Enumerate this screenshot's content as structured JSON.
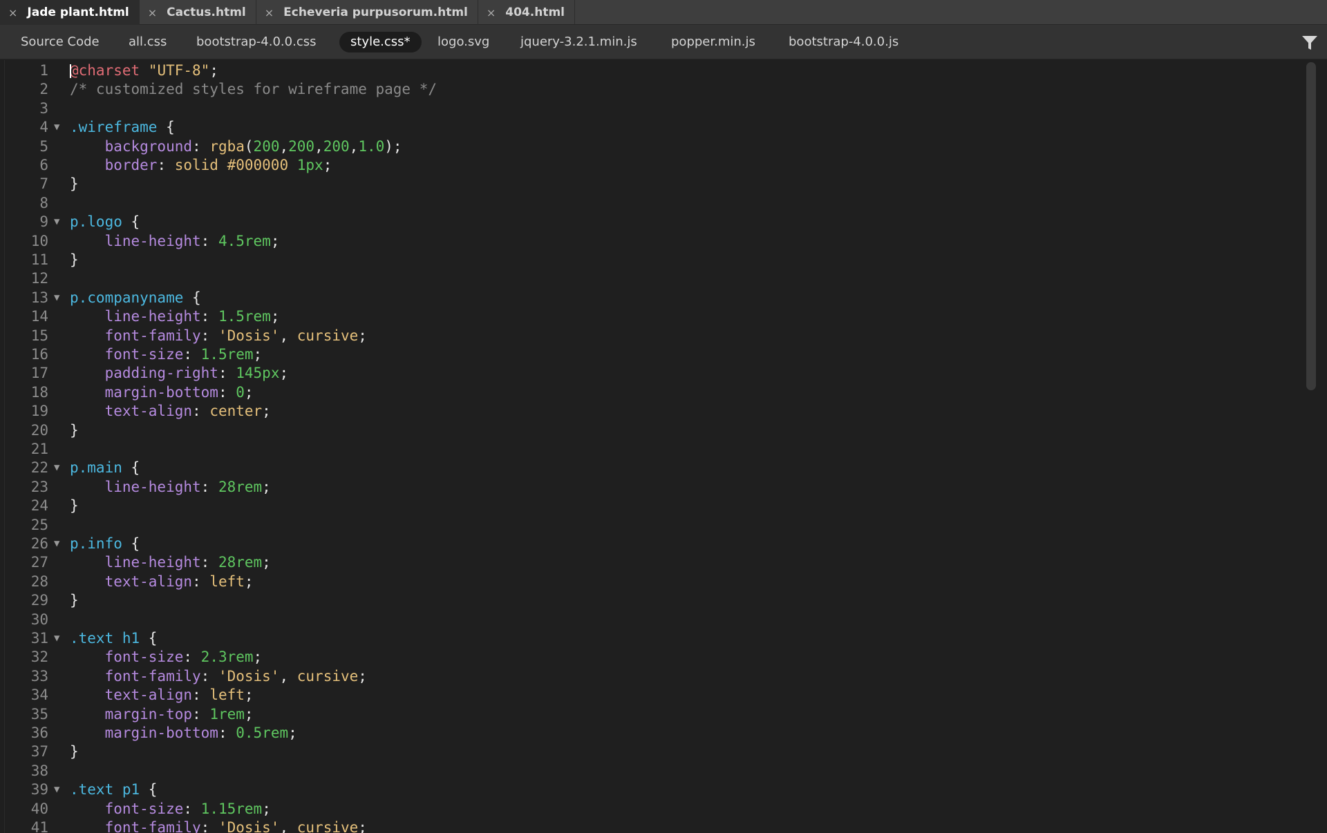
{
  "file_tabs": [
    {
      "name": "Jade plant.html",
      "active": true
    },
    {
      "name": "Cactus.html",
      "active": false
    },
    {
      "name": "Echeveria purpusorum.html",
      "active": false
    },
    {
      "name": "404.html",
      "active": false
    }
  ],
  "close_glyph": "×",
  "related_files": [
    {
      "name": "Source Code",
      "active": false
    },
    {
      "name": "all.css",
      "active": false
    },
    {
      "name": "bootstrap-4.0.0.css",
      "active": false
    },
    {
      "name": "style.css*",
      "active": true
    },
    {
      "name": "logo.svg",
      "active": false
    },
    {
      "name": "jquery-3.2.1.min.js",
      "active": false
    },
    {
      "name": "popper.min.js",
      "active": false
    },
    {
      "name": "bootstrap-4.0.0.js",
      "active": false
    }
  ],
  "filter_icon": "filter-funnel-icon",
  "fold_glyph": "▼",
  "code_lines": [
    {
      "n": "1",
      "fold": false,
      "tokens": [
        [
          "at",
          "@charset"
        ],
        [
          "punc",
          " "
        ],
        [
          "str",
          "\"UTF-8\""
        ],
        [
          "punc",
          ";"
        ]
      ]
    },
    {
      "n": "2",
      "fold": false,
      "tokens": [
        [
          "comment",
          "/* customized styles for wireframe page */"
        ]
      ]
    },
    {
      "n": "3",
      "fold": false,
      "tokens": []
    },
    {
      "n": "4",
      "fold": true,
      "tokens": [
        [
          "sel",
          ".wireframe"
        ],
        [
          "punc",
          " {"
        ]
      ]
    },
    {
      "n": "5",
      "fold": false,
      "tokens": [
        [
          "punc",
          "    "
        ],
        [
          "prop",
          "background"
        ],
        [
          "punc",
          ": "
        ],
        [
          "val",
          "rgba"
        ],
        [
          "punc",
          "("
        ],
        [
          "num",
          "200"
        ],
        [
          "punc",
          ","
        ],
        [
          "num",
          "200"
        ],
        [
          "punc",
          ","
        ],
        [
          "num",
          "200"
        ],
        [
          "punc",
          ","
        ],
        [
          "num",
          "1.0"
        ],
        [
          "punc",
          ");"
        ]
      ]
    },
    {
      "n": "6",
      "fold": false,
      "tokens": [
        [
          "punc",
          "    "
        ],
        [
          "prop",
          "border"
        ],
        [
          "punc",
          ": "
        ],
        [
          "val",
          "solid #000000"
        ],
        [
          "punc",
          " "
        ],
        [
          "num",
          "1px"
        ],
        [
          "punc",
          ";"
        ]
      ]
    },
    {
      "n": "7",
      "fold": false,
      "tokens": [
        [
          "punc",
          "}"
        ]
      ]
    },
    {
      "n": "8",
      "fold": false,
      "tokens": []
    },
    {
      "n": "9",
      "fold": true,
      "tokens": [
        [
          "sel",
          "p.logo"
        ],
        [
          "punc",
          " {"
        ]
      ]
    },
    {
      "n": "10",
      "fold": false,
      "tokens": [
        [
          "punc",
          "    "
        ],
        [
          "prop",
          "line-height"
        ],
        [
          "punc",
          ": "
        ],
        [
          "num",
          "4.5rem"
        ],
        [
          "punc",
          ";"
        ]
      ]
    },
    {
      "n": "11",
      "fold": false,
      "tokens": [
        [
          "punc",
          "}"
        ]
      ]
    },
    {
      "n": "12",
      "fold": false,
      "tokens": []
    },
    {
      "n": "13",
      "fold": true,
      "tokens": [
        [
          "sel",
          "p.companyname"
        ],
        [
          "punc",
          " {"
        ]
      ]
    },
    {
      "n": "14",
      "fold": false,
      "tokens": [
        [
          "punc",
          "    "
        ],
        [
          "prop",
          "line-height"
        ],
        [
          "punc",
          ": "
        ],
        [
          "num",
          "1.5rem"
        ],
        [
          "punc",
          ";"
        ]
      ]
    },
    {
      "n": "15",
      "fold": false,
      "tokens": [
        [
          "punc",
          "    "
        ],
        [
          "prop",
          "font-family"
        ],
        [
          "punc",
          ": "
        ],
        [
          "str",
          "'Dosis'"
        ],
        [
          "punc",
          ", "
        ],
        [
          "val",
          "cursive"
        ],
        [
          "punc",
          ";"
        ]
      ]
    },
    {
      "n": "16",
      "fold": false,
      "tokens": [
        [
          "punc",
          "    "
        ],
        [
          "prop",
          "font-size"
        ],
        [
          "punc",
          ": "
        ],
        [
          "num",
          "1.5rem"
        ],
        [
          "punc",
          ";"
        ]
      ]
    },
    {
      "n": "17",
      "fold": false,
      "tokens": [
        [
          "punc",
          "    "
        ],
        [
          "prop",
          "padding-right"
        ],
        [
          "punc",
          ": "
        ],
        [
          "num",
          "145px"
        ],
        [
          "punc",
          ";"
        ]
      ]
    },
    {
      "n": "18",
      "fold": false,
      "tokens": [
        [
          "punc",
          "    "
        ],
        [
          "prop",
          "margin-bottom"
        ],
        [
          "punc",
          ": "
        ],
        [
          "num",
          "0"
        ],
        [
          "punc",
          ";"
        ]
      ]
    },
    {
      "n": "19",
      "fold": false,
      "tokens": [
        [
          "punc",
          "    "
        ],
        [
          "prop",
          "text-align"
        ],
        [
          "punc",
          ": "
        ],
        [
          "val",
          "center"
        ],
        [
          "punc",
          ";"
        ]
      ]
    },
    {
      "n": "20",
      "fold": false,
      "tokens": [
        [
          "punc",
          "}"
        ]
      ]
    },
    {
      "n": "21",
      "fold": false,
      "tokens": []
    },
    {
      "n": "22",
      "fold": true,
      "tokens": [
        [
          "sel",
          "p.main"
        ],
        [
          "punc",
          " {"
        ]
      ]
    },
    {
      "n": "23",
      "fold": false,
      "tokens": [
        [
          "punc",
          "    "
        ],
        [
          "prop",
          "line-height"
        ],
        [
          "punc",
          ": "
        ],
        [
          "num",
          "28rem"
        ],
        [
          "punc",
          ";"
        ]
      ]
    },
    {
      "n": "24",
      "fold": false,
      "tokens": [
        [
          "punc",
          "}"
        ]
      ]
    },
    {
      "n": "25",
      "fold": false,
      "tokens": []
    },
    {
      "n": "26",
      "fold": true,
      "tokens": [
        [
          "sel",
          "p.info"
        ],
        [
          "punc",
          " {"
        ]
      ]
    },
    {
      "n": "27",
      "fold": false,
      "tokens": [
        [
          "punc",
          "    "
        ],
        [
          "prop",
          "line-height"
        ],
        [
          "punc",
          ": "
        ],
        [
          "num",
          "28rem"
        ],
        [
          "punc",
          ";"
        ]
      ]
    },
    {
      "n": "28",
      "fold": false,
      "tokens": [
        [
          "punc",
          "    "
        ],
        [
          "prop",
          "text-align"
        ],
        [
          "punc",
          ": "
        ],
        [
          "val",
          "left"
        ],
        [
          "punc",
          ";"
        ]
      ]
    },
    {
      "n": "29",
      "fold": false,
      "tokens": [
        [
          "punc",
          "}"
        ]
      ]
    },
    {
      "n": "30",
      "fold": false,
      "tokens": []
    },
    {
      "n": "31",
      "fold": true,
      "tokens": [
        [
          "sel",
          ".text h1"
        ],
        [
          "punc",
          " {"
        ]
      ]
    },
    {
      "n": "32",
      "fold": false,
      "tokens": [
        [
          "punc",
          "    "
        ],
        [
          "prop",
          "font-size"
        ],
        [
          "punc",
          ": "
        ],
        [
          "num",
          "2.3rem"
        ],
        [
          "punc",
          ";"
        ]
      ]
    },
    {
      "n": "33",
      "fold": false,
      "tokens": [
        [
          "punc",
          "    "
        ],
        [
          "prop",
          "font-family"
        ],
        [
          "punc",
          ": "
        ],
        [
          "str",
          "'Dosis'"
        ],
        [
          "punc",
          ", "
        ],
        [
          "val",
          "cursive"
        ],
        [
          "punc",
          ";"
        ]
      ]
    },
    {
      "n": "34",
      "fold": false,
      "tokens": [
        [
          "punc",
          "    "
        ],
        [
          "prop",
          "text-align"
        ],
        [
          "punc",
          ": "
        ],
        [
          "val",
          "left"
        ],
        [
          "punc",
          ";"
        ]
      ]
    },
    {
      "n": "35",
      "fold": false,
      "tokens": [
        [
          "punc",
          "    "
        ],
        [
          "prop",
          "margin-top"
        ],
        [
          "punc",
          ": "
        ],
        [
          "num",
          "1rem"
        ],
        [
          "punc",
          ";"
        ]
      ]
    },
    {
      "n": "36",
      "fold": false,
      "tokens": [
        [
          "punc",
          "    "
        ],
        [
          "prop",
          "margin-bottom"
        ],
        [
          "punc",
          ": "
        ],
        [
          "num",
          "0.5rem"
        ],
        [
          "punc",
          ";"
        ]
      ]
    },
    {
      "n": "37",
      "fold": false,
      "tokens": [
        [
          "punc",
          "}"
        ]
      ]
    },
    {
      "n": "38",
      "fold": false,
      "tokens": []
    },
    {
      "n": "39",
      "fold": true,
      "tokens": [
        [
          "sel",
          ".text p1"
        ],
        [
          "punc",
          " {"
        ]
      ]
    },
    {
      "n": "40",
      "fold": false,
      "tokens": [
        [
          "punc",
          "    "
        ],
        [
          "prop",
          "font-size"
        ],
        [
          "punc",
          ": "
        ],
        [
          "num",
          "1.15rem"
        ],
        [
          "punc",
          ";"
        ]
      ]
    },
    {
      "n": "41",
      "fold": false,
      "tokens": [
        [
          "punc",
          "    "
        ],
        [
          "prop",
          "font-family"
        ],
        [
          "punc",
          ": "
        ],
        [
          "str",
          "'Dosis'"
        ],
        [
          "punc",
          ", "
        ],
        [
          "val",
          "cursive"
        ],
        [
          "punc",
          ";"
        ]
      ]
    }
  ]
}
